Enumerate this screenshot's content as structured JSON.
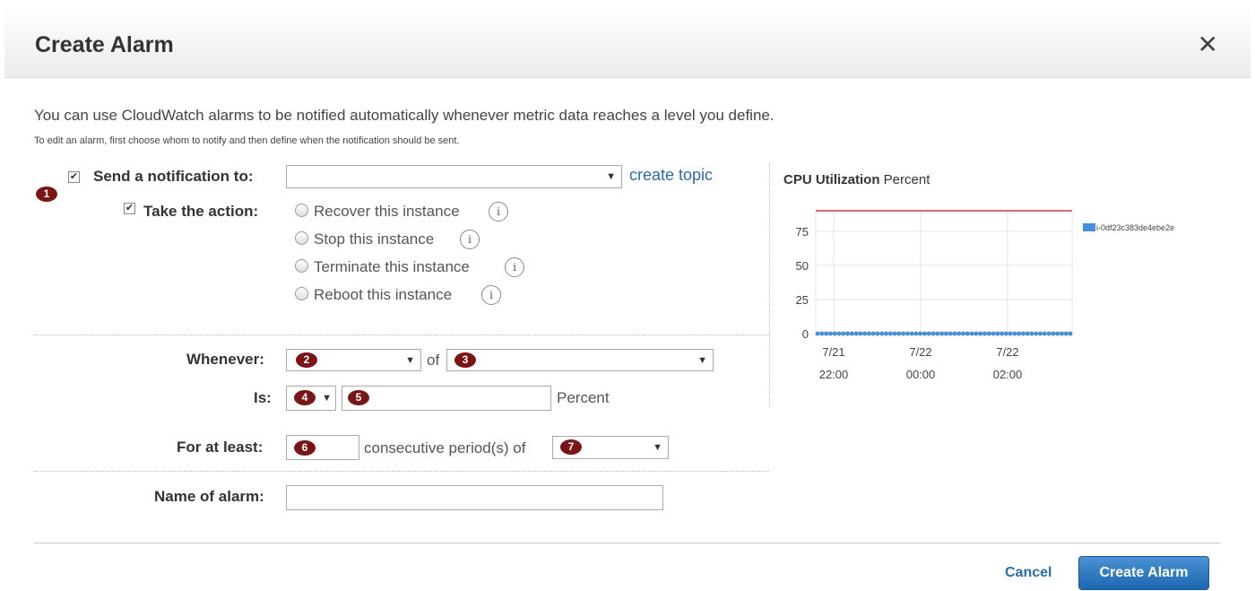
{
  "dialog": {
    "title": "Create Alarm",
    "close_glyph": "✕",
    "intro": "You can use CloudWatch alarms to be notified automatically whenever metric data reaches a level you define.",
    "subtext": "To edit an alarm, first choose whom to notify and then define when the notification should be sent."
  },
  "notification": {
    "label": "Send a notification to:",
    "checked": true,
    "value": "",
    "create_topic": "create topic"
  },
  "action": {
    "label": "Take the action:",
    "checked": true,
    "options": [
      {
        "label": "Recover this instance"
      },
      {
        "label": "Stop this instance"
      },
      {
        "label": "Terminate this instance"
      },
      {
        "label": "Reboot this instance"
      }
    ]
  },
  "badges": [
    "1",
    "2",
    "3",
    "4",
    "5",
    "6",
    "7"
  ],
  "condition": {
    "whenever_label": "Whenever:",
    "of_label": "of",
    "is_label": "Is:",
    "threshold_unit": "Percent",
    "for_at_least_label": "For at least:",
    "consecutive_label": "consecutive period(s) of",
    "name_label": "Name of alarm:",
    "name_value": ""
  },
  "chart_panel": {
    "title_bold": "CPU Utilization",
    "title_unit": "Percent"
  },
  "chart_data": {
    "type": "line",
    "title": "CPU Utilization Percent",
    "x_tick_labels": [
      [
        "7/21",
        "22:00"
      ],
      [
        "7/22",
        "00:00"
      ],
      [
        "7/22",
        "02:00"
      ]
    ],
    "y_ticks": [
      0,
      25,
      50,
      75
    ],
    "ylim": [
      0,
      90
    ],
    "grid": true,
    "legend_position": "right",
    "threshold_line": {
      "value": 90,
      "color": "#d33a3a"
    },
    "series": [
      {
        "name": "i-0df23c383de4ebe2e",
        "color": "#4a90d9",
        "values": [
          0,
          0,
          0,
          0,
          0,
          0,
          0,
          0,
          0,
          0,
          0,
          0,
          0,
          0,
          0,
          0,
          0,
          0,
          0,
          0,
          0,
          0,
          0,
          0,
          0,
          0,
          0,
          0,
          0,
          0,
          0,
          0,
          0,
          0,
          0,
          0,
          0,
          0,
          0,
          0,
          0,
          0,
          0,
          0,
          0,
          0,
          0,
          0,
          0,
          0,
          0,
          0,
          0,
          0,
          0,
          0,
          0,
          0,
          0,
          0
        ]
      }
    ]
  },
  "footer": {
    "cancel": "Cancel",
    "submit": "Create Alarm"
  },
  "colors": {
    "accent": "#2b6ca8",
    "badge": "#7a1515",
    "primary_button": "#2f7cc4"
  }
}
